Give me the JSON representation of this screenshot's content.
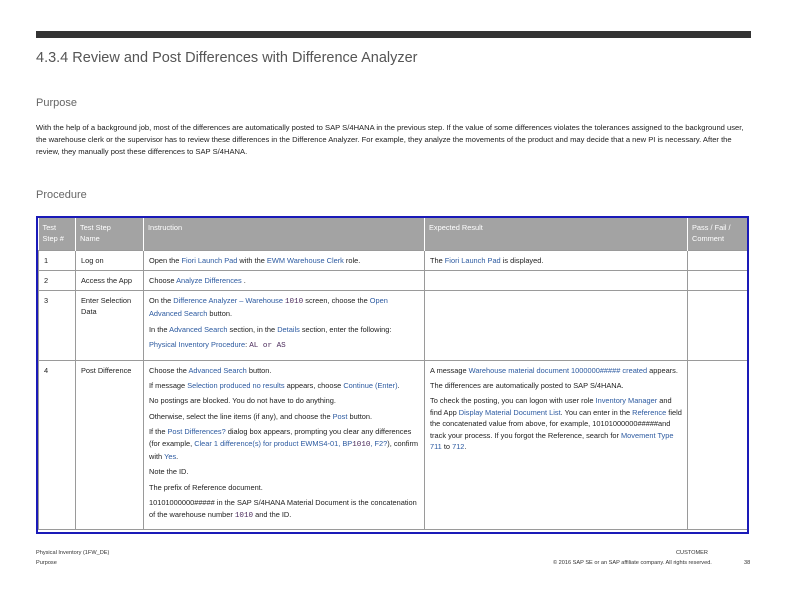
{
  "heading": "4.3.4 Review and Post Differences with Difference Analyzer",
  "purpose_heading": "Purpose",
  "purpose_text": "With the help of a background job, most of the differences are automatically posted to SAP S/4HANA in the previous step. If the value of some differences violates the tolerances assigned to the background user, the warehouse clerk or the supervisor has to review these differences in the Difference Analyzer. For example, they analyze the movements of the product and may decide that a new PI is necessary. After the review, they manually post these differences to SAP S/4HANA.",
  "procedure_heading": "Procedure",
  "table": {
    "headers": {
      "step_a": "Test",
      "step_b": "Step #",
      "name_a": "Test Step",
      "name_b": "Name",
      "instruction": "Instruction",
      "expected": "Expected Result",
      "pass_a": "Pass / Fail /",
      "pass_b": "Comment"
    },
    "row1": {
      "num": "1",
      "name": "Log on",
      "i1": "Open the ",
      "i2": "Fiori Launch Pad",
      "i3": " with the ",
      "i4": "EWM Warehouse Clerk",
      "i5": " role.",
      "e1": "The ",
      "e2": "Fiori Launch Pad",
      "e3": " is displayed."
    },
    "row2": {
      "num": "2",
      "name": "Access the App",
      "i1": "Choose ",
      "i2": "Analyze Differences",
      "i3": " ."
    },
    "row3": {
      "num": "3",
      "name": "Enter Selection Data",
      "p1a": "On the ",
      "p1b": "Difference Analyzer – Warehouse ",
      "p1c": "1010",
      "p1d": " screen, choose the ",
      "p1e": "Open Advanced Search",
      "p1f": " button.",
      "p2a": "In the ",
      "p2b": "Advanced Search",
      "p2c": " section, in the ",
      "p2d": "Details",
      "p2e": " section, enter the following:",
      "p3a": "Physical Inventory Procedure",
      "p3b": ": ",
      "p3c": "AL or AS"
    },
    "row4": {
      "num": "4",
      "name": "Post Difference",
      "p1a": "Choose the ",
      "p1b": "Advanced Search",
      "p1c": " button.",
      "p2a": "If message ",
      "p2b": "Selection produced no results",
      "p2c": " appears, choose ",
      "p2d": "Continue (Enter)",
      "p2e": ".",
      "p3": "No postings are blocked. You do not have to do anything.",
      "p4a": "Otherwise, select the line items (if any), and choose the ",
      "p4b": "Post",
      "p4c": " button.",
      "p5a": "If the ",
      "p5b": "Post Differences?",
      "p5c": " dialog box appears, prompting you clear any differences (for example, ",
      "p5d": "Clear 1 difference(s) for product EWMS4-01, BP",
      "p5e": "1010",
      "p5f": ", F2?",
      "p5g": "), confirm with ",
      "p5h": "Yes",
      "p5i": ".",
      "p6": "Note the ID.",
      "p7": "The prefix of Reference document.",
      "p8a": "10101000000##### in the SAP S/4HANA Material Document is the concatenation of the warehouse number ",
      "p8b": "1010",
      "p8c": " and the ID.",
      "e1a": "A message ",
      "e1b": "Warehouse material document 1000000##### created",
      "e1c": " appears.",
      "e2": "The differences are automatically posted to SAP S/4HANA.",
      "e3a": "To check the posting, you can logon with user role ",
      "e3b": "Inventory Manager",
      "e3c": " and find App ",
      "e3d": "Display Material Document List",
      "e3e": ". You can enter in the ",
      "e3f": "Reference",
      "e3g": " field the concatenated value from above, for example, 10101000000#####and track your process. If you forgot the Reference, search for ",
      "e3h": "Movement Type 711",
      "e3i": " to ",
      "e3j": "712",
      "e3k": "."
    }
  },
  "footer": {
    "doc_title": "Physical Inventory (1FW_DE)",
    "section": "Purpose",
    "classification": "CUSTOMER",
    "copyright": "© 2016 SAP SE or an SAP affiliate company. All rights reserved.",
    "page": "38"
  },
  "colors": {
    "link": "#2c5aa0",
    "table_border": "#1a1ab8",
    "header_bg": "#a3a3a3",
    "top_bar": "#333333"
  }
}
